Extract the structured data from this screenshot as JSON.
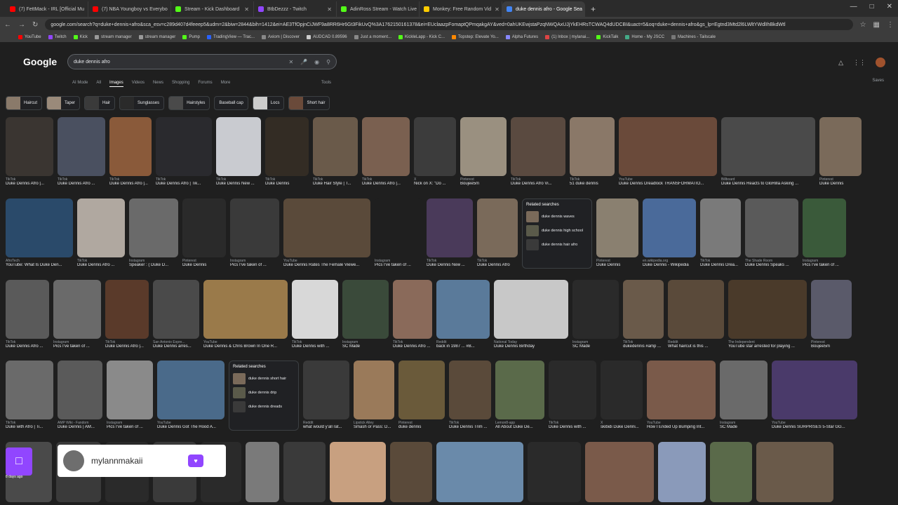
{
  "browser": {
    "tabs": [
      {
        "label": "(7) FettMack - IRL [Official Mu",
        "color": "#ff0000"
      },
      {
        "label": "(7) NBA Youngboy vs Everybo",
        "color": "#ff0000"
      },
      {
        "label": "Stream - Kick Dashboard",
        "color": "#53fc18"
      },
      {
        "label": "BtbDezzz - Twitch",
        "color": "#9146ff"
      },
      {
        "label": "AdinRoss Stream - Watch Live",
        "color": "#53fc18"
      },
      {
        "label": "Monkey: Free Random Vid",
        "color": "#ffcc00"
      },
      {
        "label": "duke dennis afro - Google Sea",
        "color": "#4285f4"
      }
    ],
    "url": "google.com/search?q=duke+dennis+afro&sca_esv=c289d407d4feeep5&udm=2&biw=2844&bih=1412&ei=AE3TfOpjnCiJWF9a8RR6Hr6Gt3FikUvQ%3A1762150161378&ei=EUclaazpFomaptQPmqakgAY&ved=0ahUKEwjstaPzqNWQAxUJjYkEHRsTCWAQ4dUDCBI&uact=5&oq=duke+dennis+afro&gs_lp=Egtnd3Mtd2l6LWltYWdlIhBkdWtl",
    "bookmarks": [
      "YouTube",
      "Twitch",
      "Kick",
      "stream manager",
      "stream manager",
      "Pump",
      "TradingView — Trac...",
      "Axiom | Discover",
      "AUDCAD 0.89596",
      "Just a moment...",
      "KickleLapp - Kick C...",
      "Topstep: Elevate Yo...",
      "Alpha Futures",
      "(1) Inbox | mylanai...",
      "KickTalk",
      "Home - My JSCC",
      "Machines - Tailscale"
    ]
  },
  "google": {
    "logo": "Google",
    "query": "duke dennis afro",
    "nav": [
      "AI Mode",
      "All",
      "Images",
      "Videos",
      "News",
      "Shopping",
      "Forums",
      "More"
    ],
    "active_nav": "Images",
    "tools": "Tools",
    "saves": "Saves",
    "chips": [
      "Haircut",
      "Taper",
      "Hair",
      "Sunglasses",
      "Hairstyles",
      "Baseball cap",
      "Locs",
      "Short hair"
    ]
  },
  "rows": [
    {
      "cards": [
        {
          "w": 68,
          "src": "TikTok",
          "t": "Duke Dennis Afro |...",
          "c": "#3a3531"
        },
        {
          "w": 68,
          "src": "TikTok",
          "t": "Duke Dennis Afro ...",
          "c": "#4a5060"
        },
        {
          "w": 60,
          "src": "TikTok",
          "t": "Duke Dennis Afro |...",
          "c": "#8a5a3a"
        },
        {
          "w": 80,
          "src": "TikTok",
          "t": "Duke Dennis Afro | Tik...",
          "c": "#2a2a2e"
        },
        {
          "w": 64,
          "src": "TikTok",
          "t": "Duke Dennis New ...",
          "c": "#c9cbd0"
        },
        {
          "w": 62,
          "src": "TikTok",
          "t": "Duke Dennis",
          "c": "#332c24"
        },
        {
          "w": 64,
          "src": "TikTok",
          "t": "Duke Hair Style | T...",
          "c": "#6a5a4a"
        },
        {
          "w": 68,
          "src": "TikTok",
          "t": "Duke Dennis Afro |...",
          "c": "#7a6050"
        },
        {
          "w": 60,
          "src": "X",
          "t": "Nick on X: \"Do ...",
          "c": "#3c3c3c"
        },
        {
          "w": 66,
          "src": "Pinterest",
          "t": "Boujee5m",
          "c": "#9a9080"
        },
        {
          "w": 78,
          "src": "TikTok",
          "t": "Duke Dennis Afro Vi...",
          "c": "#5a4a40"
        },
        {
          "w": 64,
          "src": "TikTok",
          "t": "51 duke dennis",
          "c": "#8a7868"
        },
        {
          "w": 140,
          "src": "YouTube",
          "t": "Duke Dennis Dreadlock TRANSFORMATIO...",
          "c": "#6a4a3a"
        },
        {
          "w": 134,
          "src": "Billboard",
          "t": "Duke Dennis Reacts to GloRilla Asking ...",
          "c": "#4a4a4a"
        },
        {
          "w": 60,
          "src": "Pinterest",
          "t": "Duke Dennis",
          "c": "#7a6a5a"
        }
      ]
    },
    {
      "cards": [
        {
          "w": 96,
          "src": "AfroTech",
          "t": "YouTube: What Is Duke Den...",
          "c": "#2a4a6a"
        },
        {
          "w": 68,
          "src": "TikTok",
          "t": "Duke Dennis Afro ...",
          "c": "#b0a8a0"
        },
        {
          "w": 70,
          "src": "Instagram",
          "t": "Speaker : ( Duke D...",
          "c": "#6a6a6a"
        },
        {
          "w": 62,
          "src": "Pinterest",
          "t": "Duke Dennis",
          "c": "#2a2a2a"
        },
        {
          "w": 70,
          "src": "Instagram",
          "t": "Pics I've taken of ...",
          "c": "#3a3a3a"
        },
        {
          "w": 124,
          "src": "YouTube",
          "t": "Duke Dennis Rates The Female Viewe...",
          "c": "#5a4a3a"
        },
        {
          "w": 68,
          "src": "Instagram",
          "t": "Pics I've taken of ...",
          "c": "#1f1f1f"
        },
        {
          "w": 66,
          "src": "TikTok",
          "t": "Duke Dennis New ...",
          "c": "#4a3a5a"
        },
        {
          "w": 58,
          "src": "TikTok",
          "t": "Duke Dennis Afro",
          "c": "#7a6a5a"
        },
        {
          "w": 100,
          "related": true
        },
        {
          "w": 60,
          "src": "Pinterest",
          "t": "Duke Dennis",
          "c": "#8a8070"
        },
        {
          "w": 76,
          "src": "en.wikipedia.org",
          "t": "Duke Dennis - Wikipedia",
          "c": "#4a6a9a"
        },
        {
          "w": 58,
          "src": "TikTok",
          "t": "Duke Dennis Drea...",
          "c": "#7a7a7a"
        },
        {
          "w": 76,
          "src": "The Shade Room",
          "t": "Duke Dennis Speaks ...",
          "c": "#5a5a5a"
        },
        {
          "w": 62,
          "src": "Instagram",
          "t": "Pics I've taken of ...",
          "c": "#3a5a3a"
        }
      ]
    },
    {
      "cards": [
        {
          "w": 62,
          "src": "TikTok",
          "t": "Duke Dennis Afro ...",
          "c": "#5a5a5a"
        },
        {
          "w": 68,
          "src": "Instagram",
          "t": "Pics I've taken of ...",
          "c": "#6a6a6a"
        },
        {
          "w": 62,
          "src": "TikTok",
          "t": "Duke Dennis Afro |...",
          "c": "#5a3a2a"
        },
        {
          "w": 66,
          "src": "San Antonio Expre...",
          "t": "Duke Dennis arres...",
          "c": "#4a4a4a"
        },
        {
          "w": 120,
          "src": "YouTube",
          "t": "Duke Dennis & Chris Brown In One R...",
          "c": "#9a7a4a"
        },
        {
          "w": 66,
          "src": "TikTok",
          "t": "Duke Dennis with ...",
          "c": "#d8d8d8"
        },
        {
          "w": 66,
          "src": "Instagram",
          "t": "SC Made",
          "c": "#3a4a3a"
        },
        {
          "w": 56,
          "src": "TikTok",
          "t": "Duke Dennis Afro ...",
          "c": "#8a6a5a"
        },
        {
          "w": 76,
          "src": "Reddit",
          "t": "back in 1987 ... #B...",
          "c": "#5a7a9a"
        },
        {
          "w": 106,
          "src": "National Today",
          "t": "Duke Dennis Birthday",
          "c": "#c8c8c8"
        },
        {
          "w": 66,
          "src": "Instagram",
          "t": "SC Made",
          "c": "#2a2a2a"
        },
        {
          "w": 58,
          "src": "TikTok",
          "t": "dukedennis #amp ...",
          "c": "#6a5a4a"
        },
        {
          "w": 80,
          "src": "Reddit",
          "t": "What haircut is this ...",
          "c": "#5a4a3a"
        },
        {
          "w": 112,
          "src": "The Independent",
          "t": "YouTube star arrested for playing ...",
          "c": "#4a3a2a"
        },
        {
          "w": 58,
          "src": "Pinterest",
          "t": "Boujee5m",
          "c": "#5a5a6a"
        }
      ]
    },
    {
      "cards": [
        {
          "w": 68,
          "src": "TikTok",
          "t": "Duke with Afro | Ti...",
          "c": "#6a6a6a"
        },
        {
          "w": 64,
          "src": "AMP Wiki - Fandom",
          "t": "Duke Dennis | AM...",
          "c": "#5a5a5a"
        },
        {
          "w": 66,
          "src": "Instagram",
          "t": "Pics I've taken of ...",
          "c": "#8a8a8a"
        },
        {
          "w": 96,
          "src": "YouTube",
          "t": "Duke Dennis Got The Hood A...",
          "c": "#4a6a8a"
        },
        {
          "w": 100,
          "related2": true
        },
        {
          "w": 66,
          "src": "Reddit",
          "t": "what would y'all rat...",
          "c": "#3a3a3a"
        },
        {
          "w": 58,
          "src": "Lipstick Alley",
          "t": "Smash or Pass: D...",
          "c": "#9a7a5a"
        },
        {
          "w": 66,
          "src": "Pinterest",
          "t": "duke dennis",
          "c": "#6a5a3a"
        },
        {
          "w": 60,
          "src": "TikTok",
          "t": "Duke Dennis Trim ...",
          "c": "#5a4a3a"
        },
        {
          "w": 70,
          "src": "Lemon8-app",
          "t": "All About Duke De...",
          "c": "#5a6a4a"
        },
        {
          "w": 68,
          "src": "TikTok",
          "t": "Duke Dennis with ...",
          "c": "#2a2a2a"
        },
        {
          "w": 60,
          "src": "X",
          "t": "skibidi Duke Denni...",
          "c": "#2a2a2a"
        },
        {
          "w": 98,
          "src": "YouTube",
          "t": "How I Ended Up Bumping Int...",
          "c": "#7a5a4a"
        },
        {
          "w": 68,
          "src": "Instagram",
          "t": "SC Made",
          "c": "#6a6a6a"
        },
        {
          "w": 122,
          "src": "YouTube",
          "t": "Duke Dennis SURPRISES 5-Star GG...",
          "c": "#4a3a6a"
        }
      ]
    },
    {
      "cards": [
        {
          "w": 66,
          "src": "",
          "t": "",
          "c": "#4a4a4a"
        },
        {
          "w": 64,
          "src": "",
          "t": "",
          "c": "#3a3a3a"
        },
        {
          "w": 62,
          "src": "",
          "t": "",
          "c": "#2a2a2a"
        },
        {
          "w": 62,
          "src": "",
          "t": "",
          "c": "#3a3a3a"
        },
        {
          "w": 58,
          "src": "",
          "t": "",
          "c": "#2a2a2a"
        },
        {
          "w": 48,
          "src": "",
          "t": "",
          "c": "#7a7a7a"
        },
        {
          "w": 60,
          "src": "",
          "t": "",
          "c": "#3a3a3a"
        },
        {
          "w": 80,
          "src": "",
          "t": "",
          "c": "#c8a080"
        },
        {
          "w": 60,
          "src": "",
          "t": "",
          "c": "#5a4a3a"
        },
        {
          "w": 124,
          "src": "",
          "t": "",
          "c": "#6a8aaa"
        },
        {
          "w": 76,
          "src": "",
          "t": "",
          "c": "#2a2a2a"
        },
        {
          "w": 98,
          "src": "",
          "t": "",
          "c": "#7a5a4a"
        },
        {
          "w": 68,
          "src": "",
          "t": "",
          "c": "#8a9aba"
        },
        {
          "w": 60,
          "src": "",
          "t": "",
          "c": "#5a6a4a"
        },
        {
          "w": 110,
          "src": "",
          "t": "",
          "c": "#6a5a4a"
        }
      ]
    }
  ],
  "related_searches": {
    "title": "Related searches",
    "items": [
      "duke dennis waves",
      "duke dennis high school",
      "duke dennis hair afro"
    ]
  },
  "related_searches_2": {
    "title": "Related searches",
    "items": [
      "duke dennis short hair",
      "duke dennis drip",
      "duke dennis dreads"
    ]
  },
  "twitch_alert": {
    "username": "mylannmakaii",
    "ago": "8 days ago"
  }
}
